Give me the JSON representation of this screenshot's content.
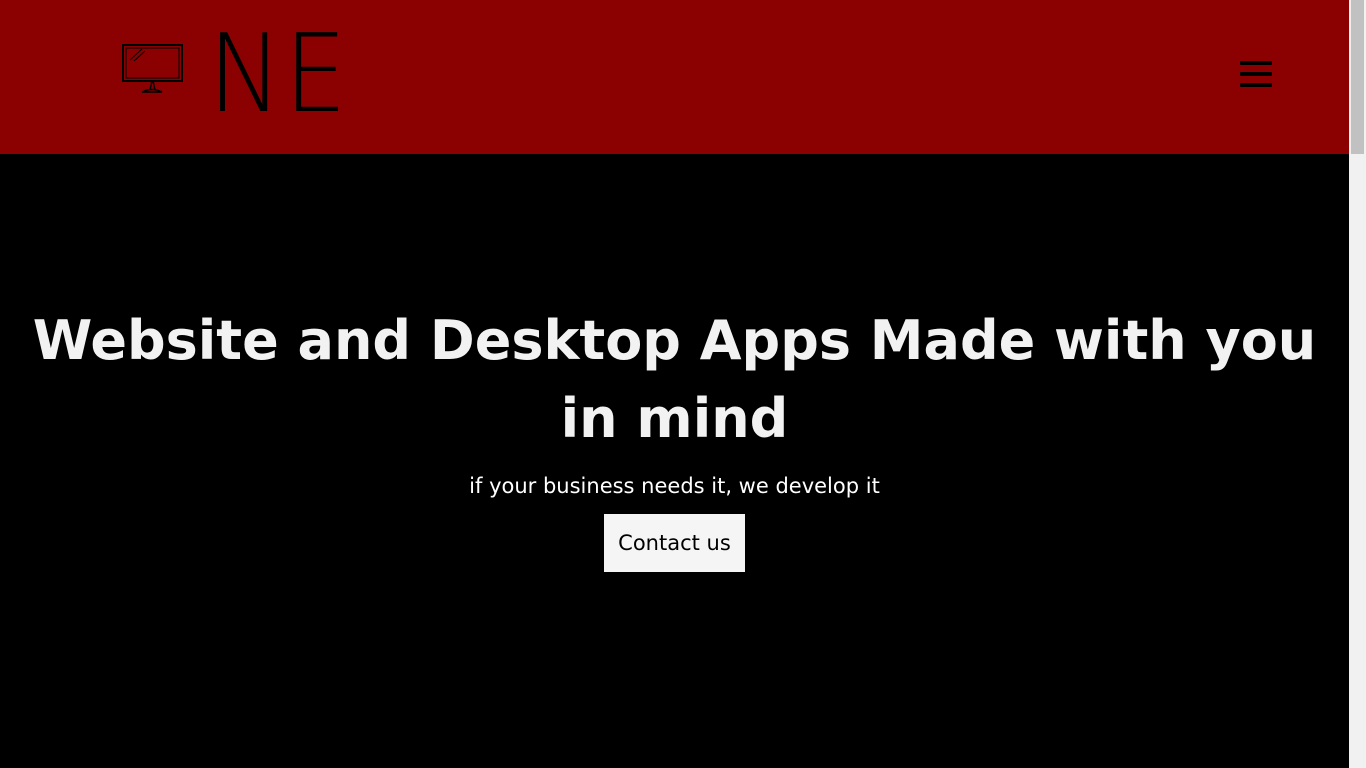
{
  "header": {
    "logo_text": "NE",
    "logo_icon": "monitor-icon",
    "menu_icon": "hamburger-menu-icon",
    "background_color": "#8b0000"
  },
  "hero": {
    "title": "Website and Desktop Apps Made with you in mind",
    "subtitle": "if your business needs it, we develop it",
    "cta_label": "Contact us",
    "background_color": "#000000"
  }
}
